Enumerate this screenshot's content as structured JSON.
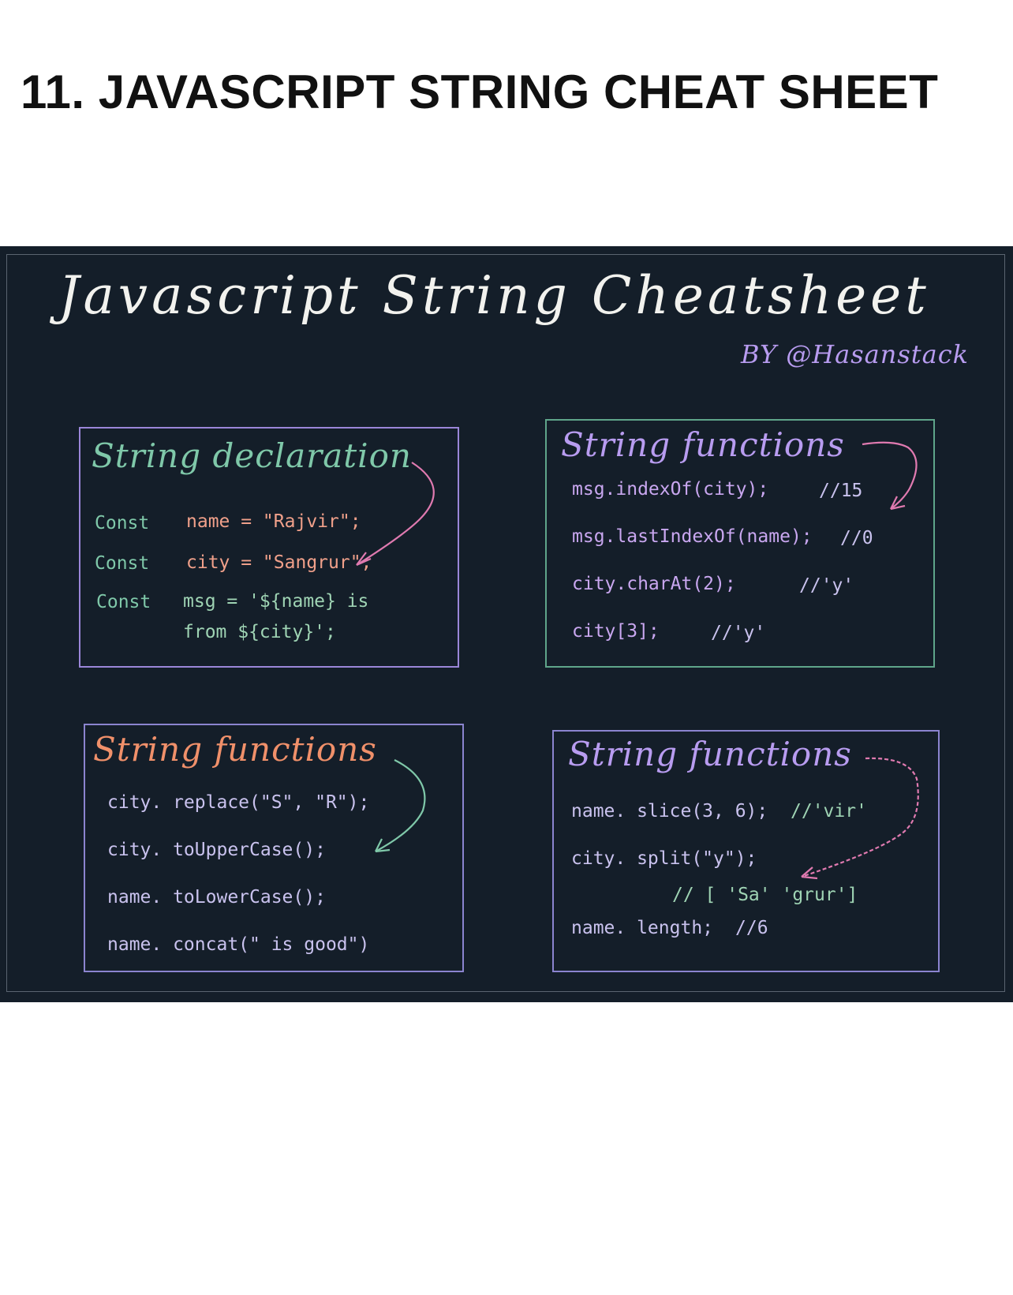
{
  "page": {
    "title": "11. JAVASCRIPT STRING CHEAT SHEET"
  },
  "board": {
    "title": "Javascript String Cheatsheet",
    "byline": "BY @Hasanstack"
  },
  "colors": {
    "board_bg": "#141e29",
    "purple": "#b89cf0",
    "green": "#7fc8a9",
    "orange": "#f0906a",
    "pink": "#e07ab0"
  },
  "cards": {
    "declaration": {
      "title": "String declaration",
      "lines": [
        {
          "keyword": "Const",
          "code": "name = \"Rajvir\";"
        },
        {
          "keyword": "Const",
          "code": "city = \"Sangrur\";"
        },
        {
          "keyword": "Const",
          "code": "msg = '${name} is",
          "cont": "from ${city}';"
        }
      ]
    },
    "functions1": {
      "title": "String functions",
      "lines": [
        {
          "code": "msg.indexOf(city);",
          "comment": "//15"
        },
        {
          "code": "msg.lastIndexOf(name);",
          "comment": "//0"
        },
        {
          "code": "city.charAt(2);",
          "comment": "//'y'"
        },
        {
          "code": "city[3];",
          "comment": "//'y'"
        }
      ]
    },
    "functions2": {
      "title": "String functions",
      "lines": [
        {
          "code": "city. replace(\"S\", \"R\");"
        },
        {
          "code": "city. toUpperCase();"
        },
        {
          "code": "name. toLowerCase();"
        },
        {
          "code": "name. concat(\" is good\")"
        }
      ]
    },
    "functions3": {
      "title": "String functions",
      "lines": [
        {
          "code": "name. slice(3, 6);",
          "comment": "//'vir'"
        },
        {
          "code": "city. split(\"y\");"
        },
        {
          "code": "// [ 'Sa' 'grur']"
        },
        {
          "code": "name. length;",
          "comment": "//6"
        }
      ]
    }
  }
}
